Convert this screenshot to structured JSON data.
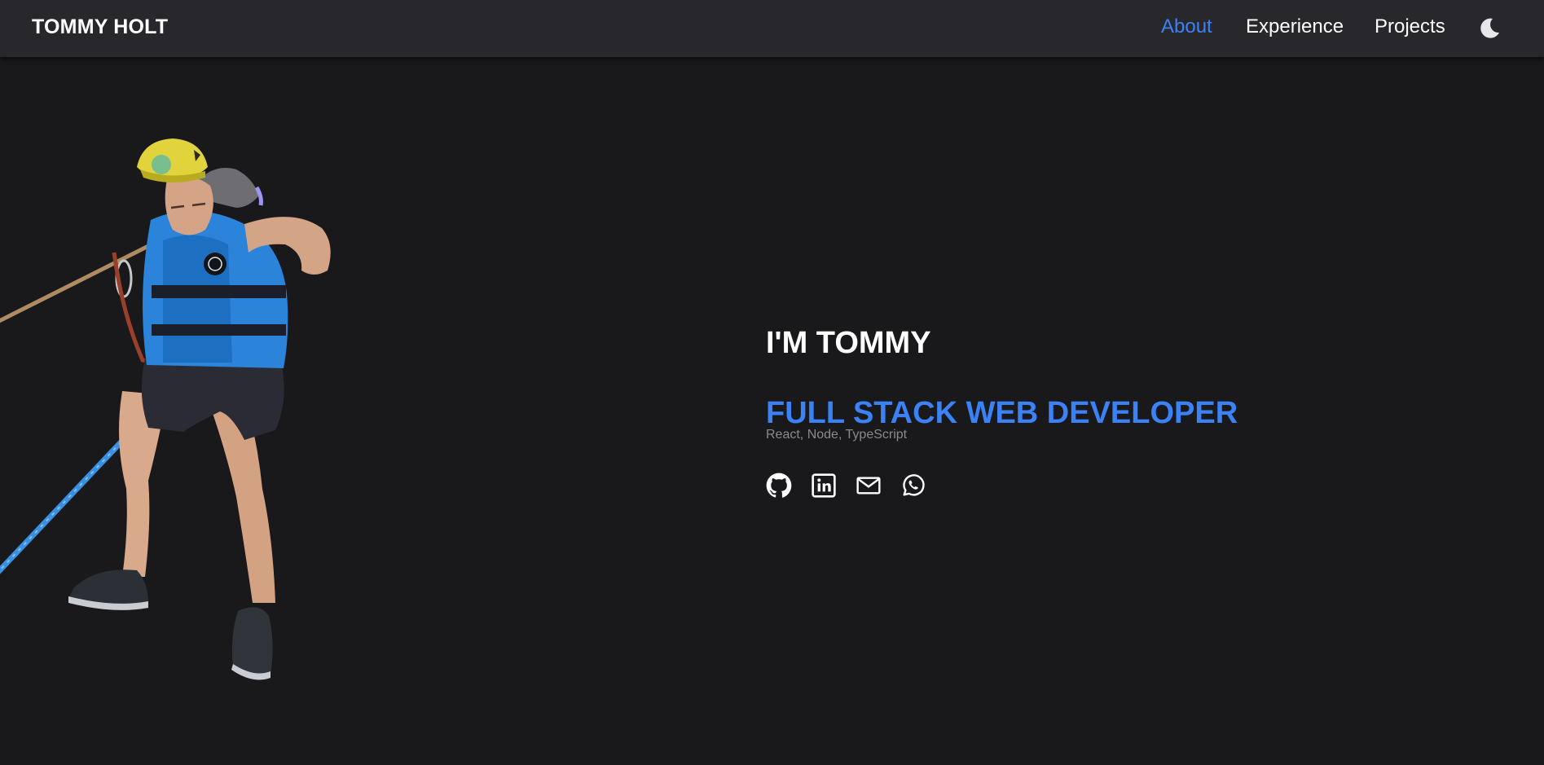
{
  "header": {
    "brand": "TOMMY HOLT",
    "nav": [
      {
        "label": "About",
        "active": true
      },
      {
        "label": "Experience",
        "active": false
      },
      {
        "label": "Projects",
        "active": false
      }
    ],
    "theme_toggle_icon": "moon-icon"
  },
  "hero": {
    "greeting": "I'M TOMMY",
    "role": "FULL STACK WEB DEVELOPER",
    "skills": "React, Node, TypeScript",
    "image_icon": "climber-photo",
    "socials": [
      {
        "icon": "github-icon"
      },
      {
        "icon": "linkedin-icon"
      },
      {
        "icon": "email-icon"
      },
      {
        "icon": "whatsapp-icon"
      }
    ]
  },
  "colors": {
    "background": "#19181b",
    "header_bg": "#28272b",
    "accent": "#3b82f6",
    "text": "#ffffff",
    "muted": "#8a8990"
  }
}
